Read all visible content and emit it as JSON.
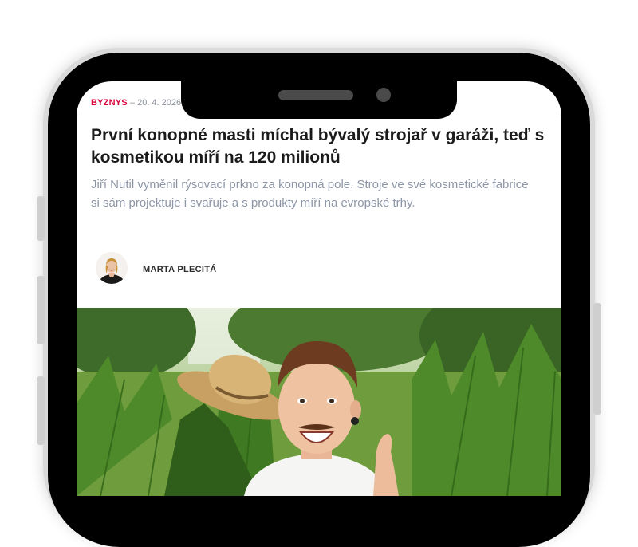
{
  "article": {
    "category": "BYZNYS",
    "separator": "–",
    "date": "20. 4. 2026",
    "headline": "První konopné masti míchal bývalý strojař v garáži, teď s kosmetikou míří na 120 milionů",
    "perex": "Jiří Nutil vyměnil rýsovací prkno za konopná pole. Stroje ve své kosmetické fabrice si sám projektuje i svařuje a s produkty míří na evropské trhy.",
    "author": "MARTA PLECITÁ"
  },
  "colors": {
    "category": "#d6003b",
    "headline": "#1b1b1b",
    "perex": "#8d96a6",
    "meta": "#8a8f98"
  }
}
